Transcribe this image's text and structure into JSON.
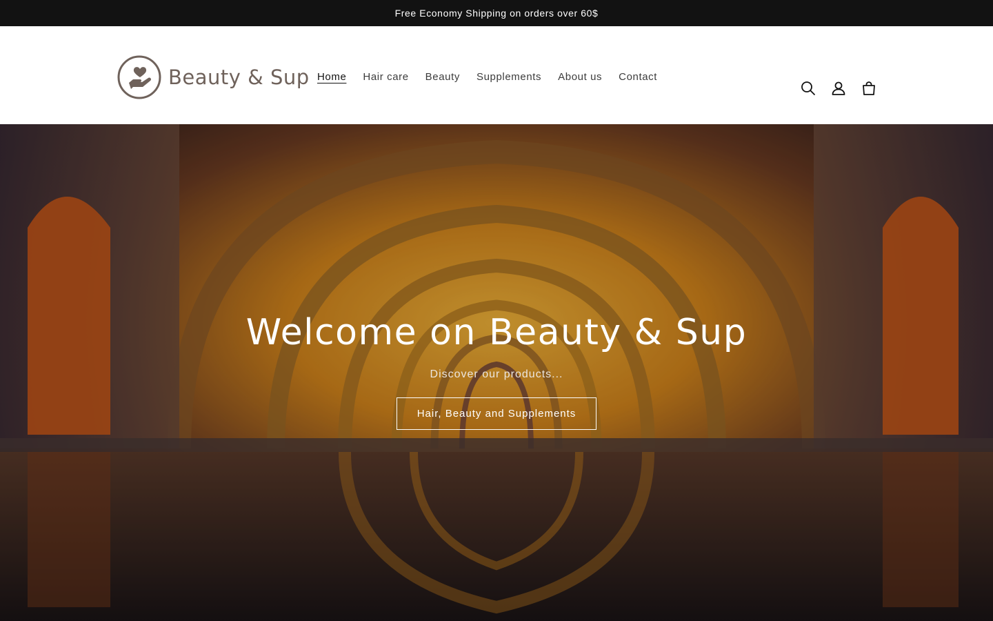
{
  "announcement": {
    "text": "Free Economy Shipping on orders over 60$"
  },
  "brand": {
    "name": "Beauty & Sup",
    "logo_icon": "hand-holding-heart-icon",
    "color": "#6f625b"
  },
  "nav": {
    "items": [
      {
        "label": "Home",
        "active": true
      },
      {
        "label": "Hair care"
      },
      {
        "label": "Beauty"
      },
      {
        "label": "Supplements"
      },
      {
        "label": "About us"
      },
      {
        "label": "Contact"
      }
    ]
  },
  "header_icons": [
    "search-icon",
    "account-icon",
    "cart-icon"
  ],
  "hero": {
    "title": "Welcome on Beauty & Sup",
    "subtitle": "Discover our products...",
    "button_label": "Hair, Beauty and Supplements"
  },
  "colors": {
    "announcement_bg": "#121212",
    "header_bg": "#ffffff",
    "accent_warm": "#d98a1a"
  }
}
